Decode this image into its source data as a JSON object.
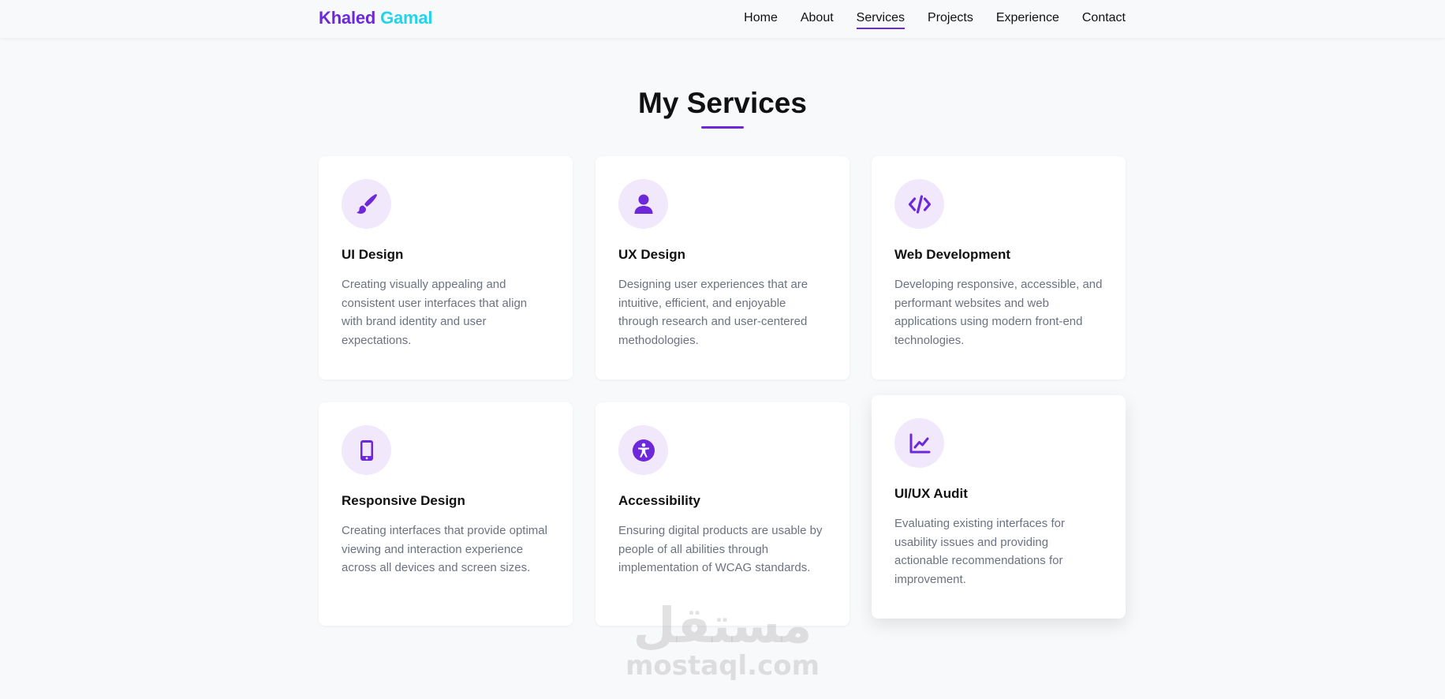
{
  "brand": {
    "first": "Khaled",
    "last": "Gamal",
    "first_color": "#6d28d9",
    "last_color": "#22d3ee"
  },
  "nav": {
    "items": [
      {
        "label": "Home"
      },
      {
        "label": "About"
      },
      {
        "label": "Services",
        "active": true
      },
      {
        "label": "Projects"
      },
      {
        "label": "Experience"
      },
      {
        "label": "Contact"
      }
    ]
  },
  "section": {
    "title": "My Services",
    "accent_color": "#6d28d9"
  },
  "services": [
    {
      "icon": "paintbrush-icon",
      "title": "UI Design",
      "description": "Creating visually appealing and consistent user interfaces that align with brand identity and user expectations."
    },
    {
      "icon": "user-icon",
      "title": "UX Design",
      "description": "Designing user experiences that are intuitive, efficient, and enjoyable through research and user-centered methodologies."
    },
    {
      "icon": "code-icon",
      "title": "Web Development",
      "description": "Developing responsive, accessible, and performant websites and web applications using modern front-end technologies."
    },
    {
      "icon": "tablet-icon",
      "title": "Responsive Design",
      "description": "Creating interfaces that provide optimal viewing and interaction experience across all devices and screen sizes."
    },
    {
      "icon": "accessibility-icon",
      "title": "Accessibility",
      "description": "Ensuring digital products are usable by people of all abilities through implementation of WCAG standards."
    },
    {
      "icon": "chart-line-icon",
      "title": "UI/UX Audit",
      "description": "Evaluating existing interfaces for usability issues and providing actionable recommendations for improvement."
    }
  ],
  "watermark": {
    "arabic": "مستقل",
    "latin": "mostaql.com"
  }
}
